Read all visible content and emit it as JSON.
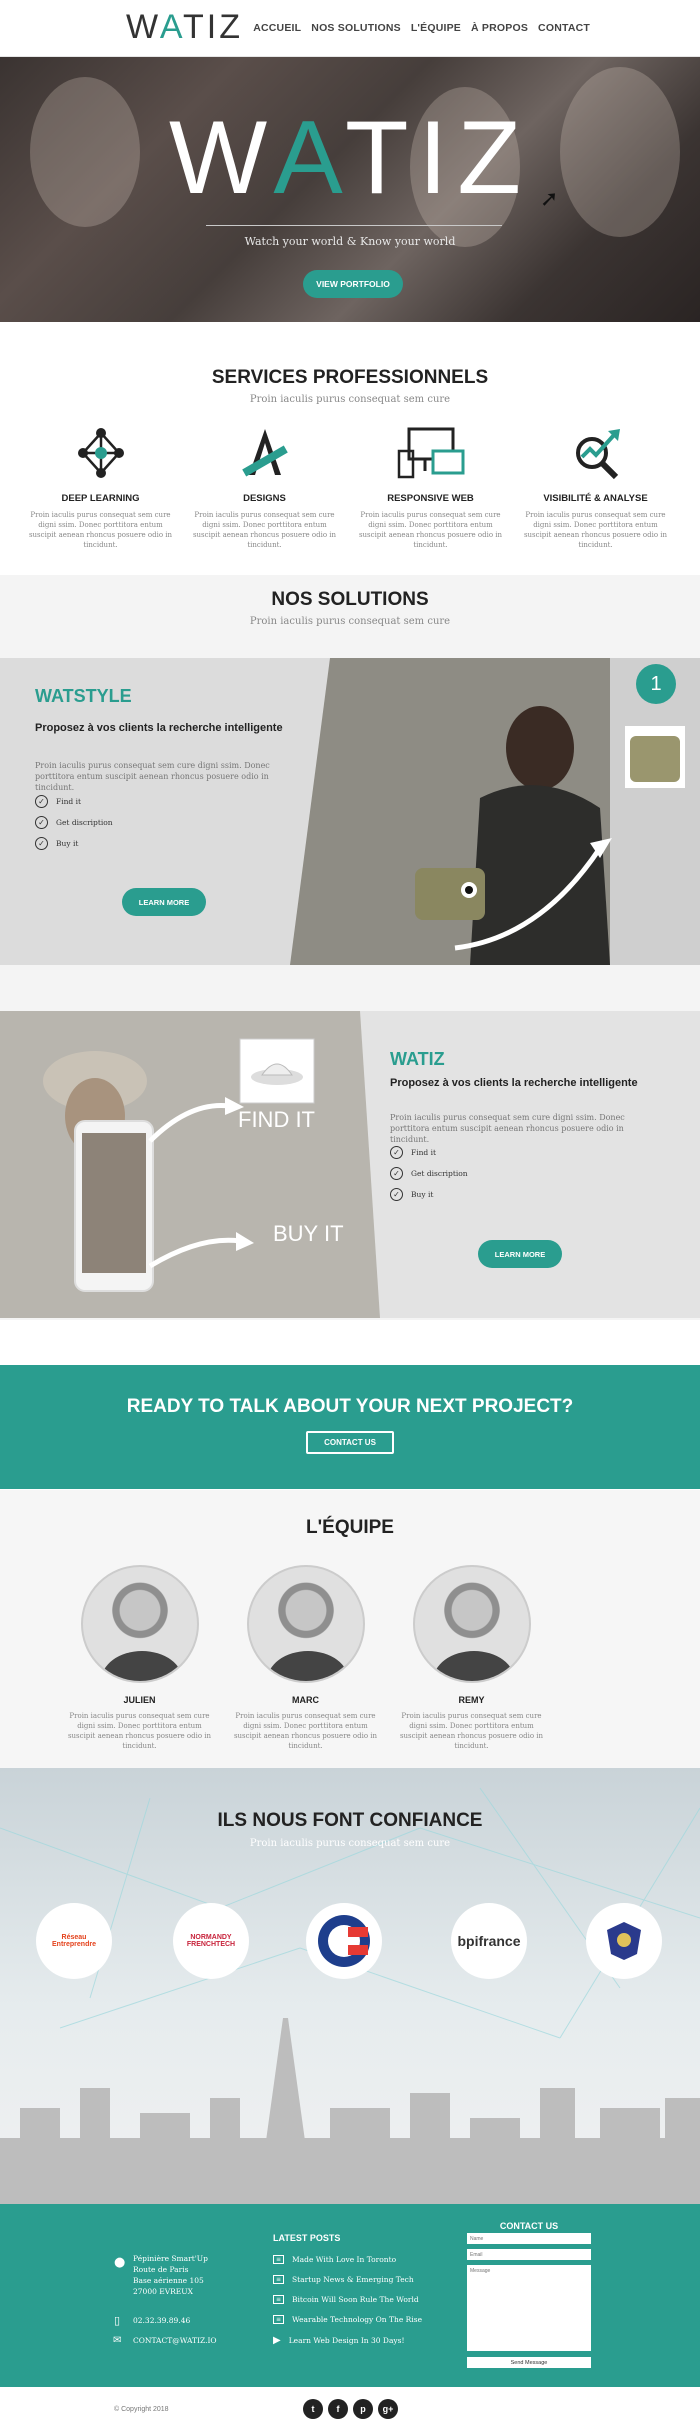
{
  "brand": {
    "logo_w": "W",
    "logo_a": "A",
    "logo_rest": "TIZ",
    "accent": "#2a9d8f"
  },
  "nav": {
    "items": [
      "ACCUEIL",
      "NOS SOLUTIONS",
      "L'ÉQUIPE",
      "À PROPOS",
      "CONTACT"
    ]
  },
  "hero": {
    "title_w": "W",
    "title_a": "A",
    "title_rest": "TIZ",
    "tagline": "Watch your world & Know your world",
    "button": "VIEW PORTFOLIO"
  },
  "services": {
    "title": "SERVICES PROFESSIONNELS",
    "subtitle": "Proin iaculis purus consequat sem cure",
    "items": [
      {
        "icon": "network-icon",
        "title": "DEEP LEARNING",
        "text": "Proin iaculis purus consequat sem cure digni ssim. Donec porttitora entum suscipit aenean rhoncus posuere odio in tincidunt."
      },
      {
        "icon": "design-tools-icon",
        "title": "DESIGNS",
        "text": "Proin iaculis purus consequat sem cure digni ssim. Donec porttitora entum suscipit aenean rhoncus posuere odio in tincidunt."
      },
      {
        "icon": "devices-icon",
        "title": "RESPONSIVE WEB",
        "text": "Proin iaculis purus consequat sem cure digni ssim. Donec porttitora entum suscipit aenean rhoncus posuere odio in tincidunt."
      },
      {
        "icon": "analytics-icon",
        "title": "VISIBILITÉ & ANALYSE",
        "text": "Proin iaculis purus consequat sem cure digni ssim. Donec porttitora entum suscipit aenean rhoncus posuere odio in tincidunt."
      }
    ]
  },
  "solutions": {
    "title": "NOS SOLUTIONS",
    "subtitle": "Proin iaculis purus consequat sem cure",
    "watstyle": {
      "name": "WATSTYLE",
      "tagline": "Proposez à vos clients la recherche intelligente",
      "text": "Proin iaculis purus consequat sem cure digni ssim. Donec porttitora entum suscipit aenean rhoncus posuere odio in tincidunt.",
      "features": [
        "Find it",
        "Get discription",
        "Buy it"
      ],
      "button": "LEARN MORE",
      "step": "1"
    },
    "watiz": {
      "name": "WATIZ",
      "tagline": "Proposez à vos clients la recherche intelligente",
      "text": "Proin iaculis purus consequat sem cure digni ssim. Donec porttitora entum suscipit aenean rhoncus posuere odio in tincidunt.",
      "features": [
        "Find it",
        "Get discription",
        "Buy it"
      ],
      "button": "LEARN MORE",
      "find_label": "FIND IT",
      "buy_label": "BUY IT"
    }
  },
  "cta": {
    "title": "READY TO TALK ABOUT YOUR NEXT PROJECT?",
    "button": "CONTACT US"
  },
  "team": {
    "title": "L'ÉQUIPE",
    "members": [
      {
        "name": "JULIEN",
        "text": "Proin iaculis purus consequat sem cure digni ssim. Donec porttitora entum suscipit aenean rhoncus posuere odio in tincidunt."
      },
      {
        "name": "MARC",
        "text": "Proin iaculis purus consequat sem cure digni ssim. Donec porttitora entum suscipit aenean rhoncus posuere odio in tincidunt."
      },
      {
        "name": "REMY",
        "text": "Proin iaculis purus consequat sem cure digni ssim. Donec porttitora entum suscipit aenean rhoncus posuere odio in tincidunt."
      }
    ]
  },
  "clients": {
    "title": "ILS NOUS FONT CONFIANCE",
    "subtitle": "Proin iaculis purus consequat sem cure",
    "logos": [
      {
        "line1": "Réseau",
        "line2": "Entreprendre"
      },
      {
        "line1": "NORMANDY",
        "line2": "FRENCHTECH"
      },
      {
        "line1": "",
        "line2": ""
      },
      {
        "line1": "bpifrance",
        "line2": ""
      },
      {
        "line1": "",
        "line2": ""
      }
    ]
  },
  "footer": {
    "address": [
      "Pépinière Smart'Up",
      "Route de Paris",
      "Base aérienne 105",
      "27000 EVREUX"
    ],
    "phone": "02.32.39.89.46",
    "email": "CONTACT@WATIZ.IO",
    "posts_title": "LATEST POSTS",
    "posts": [
      "Made With Love In Toronto",
      "Startup News & Emerging Tech",
      "Bitcoin Will Soon Rule The World",
      "Wearable Technology On The Rise",
      "Learn Web Design In 30 Days!"
    ],
    "contact_title": "CONTACT US",
    "name_ph": "Name",
    "email_ph": "Email",
    "message_ph": "Message",
    "send": "Send Message",
    "copyright": "© Copyright 2018",
    "social": [
      "t",
      "f",
      "p",
      "g+"
    ]
  }
}
